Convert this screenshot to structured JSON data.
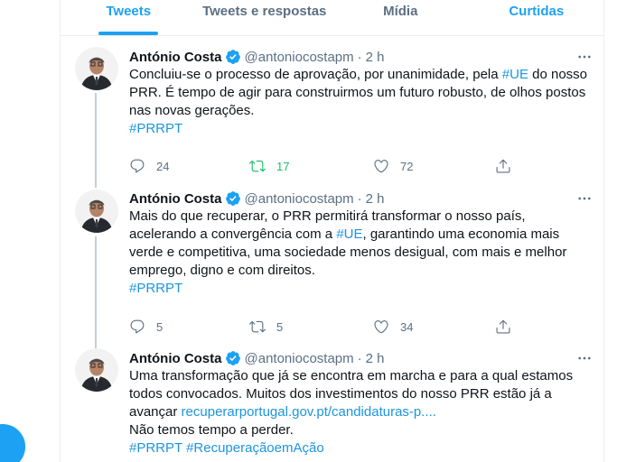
{
  "tabs": [
    {
      "label": "Tweets",
      "active": true
    },
    {
      "label": "Tweets e respostas",
      "active": false
    },
    {
      "label": "Mídia",
      "active": false
    },
    {
      "label": "Curtidas",
      "active": false
    }
  ],
  "tweets": [
    {
      "name": "António Costa",
      "handle": "@antoniocostapm",
      "separator": "·",
      "time": "2 h",
      "lines": [
        [
          "Concluiu-se o processo de aprovação, por unanimidade, pela ",
          "#UE",
          " do nosso"
        ],
        [
          "PRR. É tempo de agir para construirmos um futuro robusto, de olhos postos"
        ],
        [
          "nas novas gerações."
        ],
        [
          "",
          "#PRRPT"
        ]
      ],
      "replies": "24",
      "retweets": "17",
      "likes": "72",
      "retweeted": true
    },
    {
      "name": "António Costa",
      "handle": "@antoniocostapm",
      "separator": "·",
      "time": "2 h",
      "lines": [
        [
          "Mais do que recuperar, o PRR permitirá transformar o nosso país,"
        ],
        [
          "acelerando a convergência com a ",
          "#UE",
          ", garantindo uma economia mais"
        ],
        [
          "verde e competitiva, uma sociedade menos desigual, com mais e melhor"
        ],
        [
          "emprego, digno e com direitos."
        ],
        [
          "",
          "#PRRPT"
        ]
      ],
      "replies": "5",
      "retweets": "5",
      "likes": "34",
      "retweeted": false
    },
    {
      "name": "António Costa",
      "handle": "@antoniocostapm",
      "separator": "·",
      "time": "2 h",
      "lines": [
        [
          "Uma transformação que já se encontra em marcha e para a qual estamos"
        ],
        [
          "todos convocados. Muitos dos investimentos do nosso PRR estão já a"
        ],
        [
          "avançar ",
          "recuperarportugal.gov.pt/candidaturas-p...."
        ],
        [
          "Não temos tempo a perder."
        ],
        [
          "",
          "#PRRPT #RecuperaçãoemAção"
        ]
      ]
    }
  ],
  "colors": {
    "accent": "#1da1f2",
    "link": "#1b95e0",
    "retweet_green": "#17bf63",
    "secondary_text": "#5b7083"
  },
  "icons": {
    "verified": "verified-badge-icon",
    "more": "more-options-icon",
    "reply": "reply-icon",
    "retweet": "retweet-icon",
    "like": "heart-icon",
    "share": "share-icon",
    "compose": "compose-tweet-icon"
  }
}
